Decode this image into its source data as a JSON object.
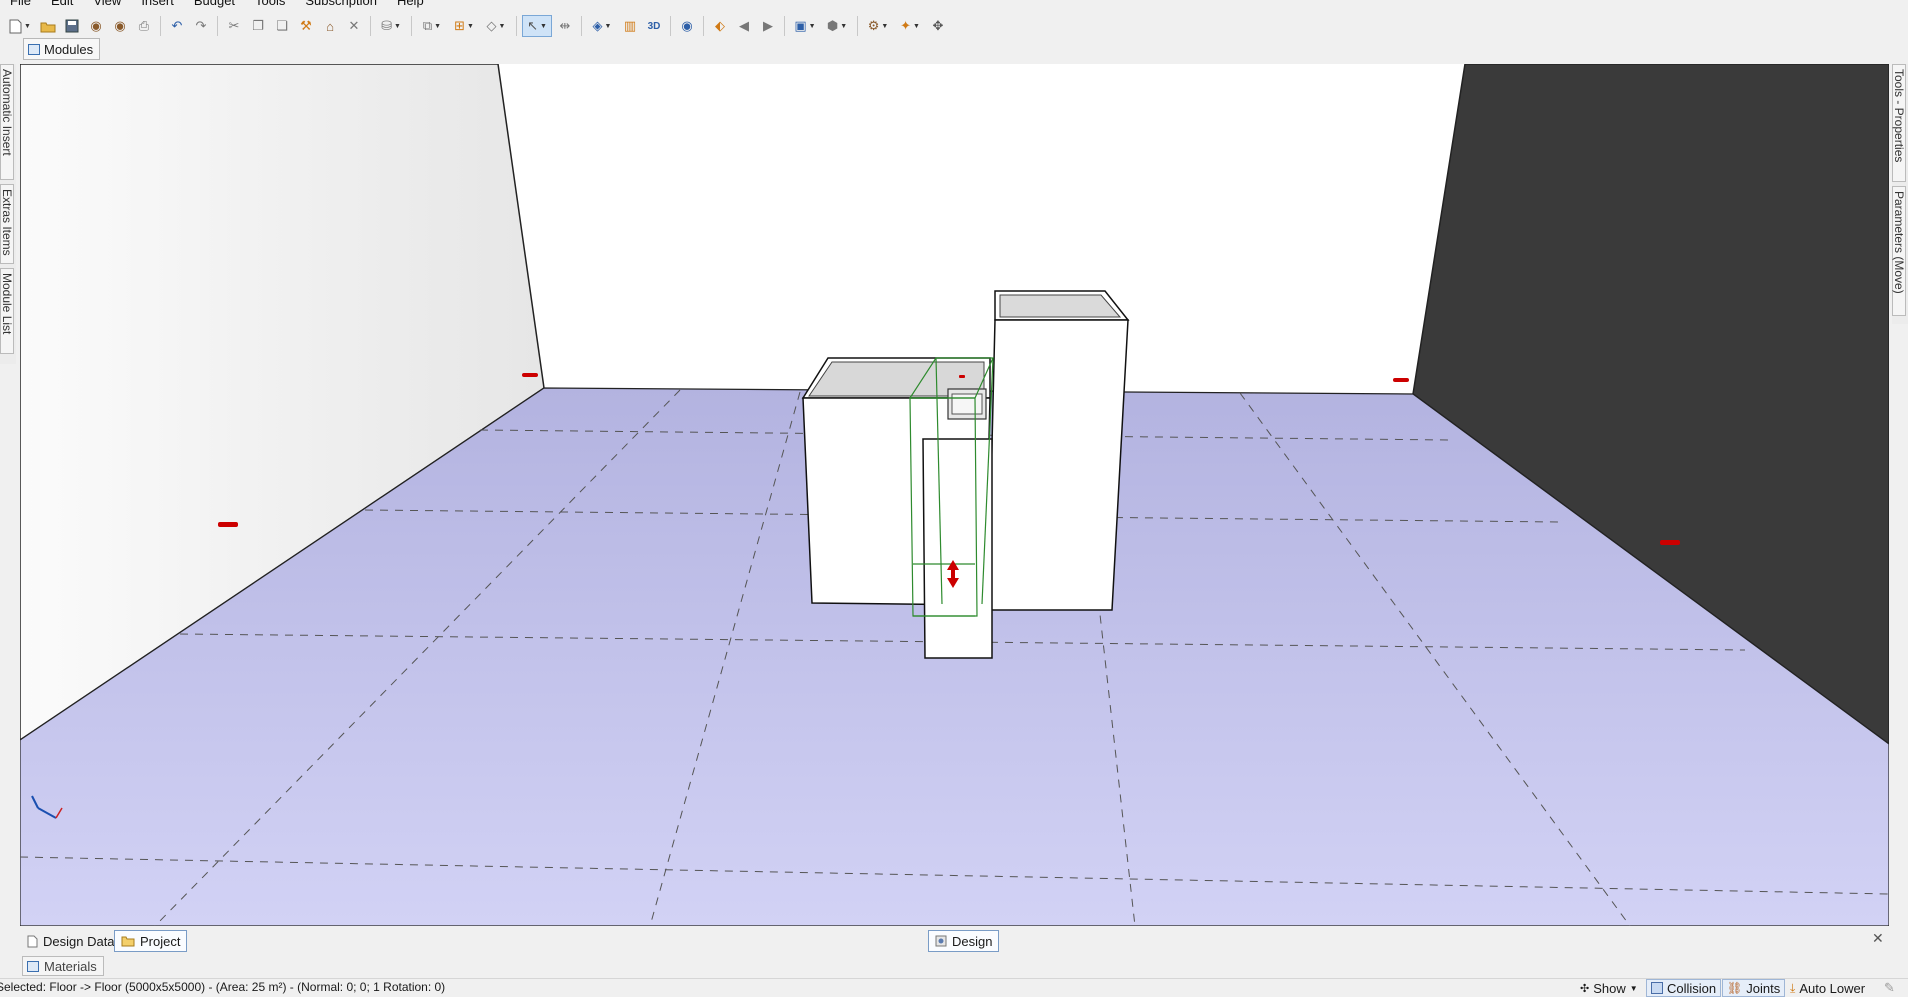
{
  "menu": [
    "File",
    "Edit",
    "View",
    "Insert",
    "Budget",
    "Tools",
    "Subscription",
    "Help"
  ],
  "toolbar": {
    "icons": [
      "new-icon",
      "open-icon",
      "save-icon",
      "render-icon",
      "render-2-icon",
      "print-icon",
      "undo-icon",
      "redo-icon",
      "cut-icon",
      "copy-icon",
      "paste-icon",
      "hammer-icon",
      "brush-icon",
      "delete-icon",
      "layers-icon",
      "arrange-icon",
      "group-icon",
      "shape-icon",
      "select-icon",
      "measure-icon",
      "cube-layers-icon",
      "dimension-icon",
      "3d-icon",
      "eye-icon",
      "view-front-icon",
      "view-left-icon",
      "view-right-icon",
      "view-box-icon",
      "box-icon",
      "tools-icon",
      "magic-icon",
      "move-icon"
    ]
  },
  "modules_tab": "Modules",
  "left_side_tabs": [
    "Automatic Insert",
    "Extras Items",
    "Module List"
  ],
  "right_side_tabs": [
    "Tools - Properties",
    "Parameters (Move)"
  ],
  "bottom_tabs": {
    "design_data": "Design Data",
    "project": "Project",
    "design": "Design"
  },
  "materials_tab": "Materials",
  "status": {
    "text": "Selected: Floor -> Floor (5000x5x5000) - (Area: 25 m²) - (Normal: 0; 0; 1 Rotation: 0)",
    "show": "Show",
    "collision": "Collision",
    "joints": "Joints",
    "auto_lower": "Auto Lower"
  },
  "colors": {
    "floor": "#ccccf2",
    "floor_far": "#b5b5e2",
    "left_wall": "#f0f0f0",
    "back_wall": "#ffffff",
    "right_wall": "#3a3a3a",
    "selection": "#2e8b2e",
    "marker": "#cc0000"
  }
}
